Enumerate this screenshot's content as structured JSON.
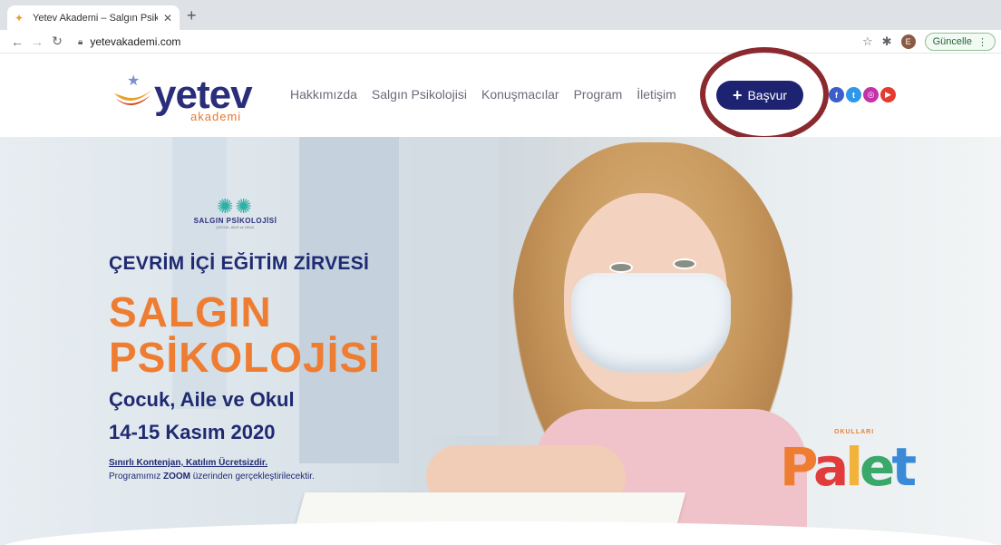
{
  "browser": {
    "tab_title": "Yetev Akademi – Salgın Psikolo",
    "tab_close": "✕",
    "new_tab": "+",
    "url": "yetevakademi.com",
    "update_label": "Güncelle",
    "avatar_letter": "E"
  },
  "site": {
    "logo_text": "yetev",
    "logo_sub": "akademi",
    "nav": [
      "Hakkımızda",
      "Salgın Psikolojisi",
      "Konuşmacılar",
      "Program",
      "İletişim"
    ],
    "apply_label": "Başvur",
    "social": [
      "facebook-icon",
      "twitter-icon",
      "instagram-icon",
      "youtube-icon"
    ]
  },
  "hero": {
    "event_logo_title": "SALGIN PSİKOLOJİSİ",
    "event_logo_sub": "ÇOCUK, AİLE ve OKUL",
    "summit": "ÇEVRİM İÇİ EĞİTİM ZİRVESİ",
    "title_line1": "SALGIN",
    "title_line2": "PSİKOLOJİSİ",
    "subtitle": "Çocuk, Aile ve Okul",
    "date": "14-15 Kasım 2020",
    "note_line1": "Sınırlı Kontenjan, Katılım Ücretsizdir.",
    "note_line2_pre": "Programımız",
    "note_line2_bold": "ZOOM",
    "note_line2_post": "üzerinden gerçekleştirilecektir.",
    "partner_arc": "OKULLARI",
    "partner_name": "Palet"
  },
  "colors": {
    "navy": "#1d2370",
    "orange": "#ee7d32",
    "annotation": "#8a2a2f"
  }
}
